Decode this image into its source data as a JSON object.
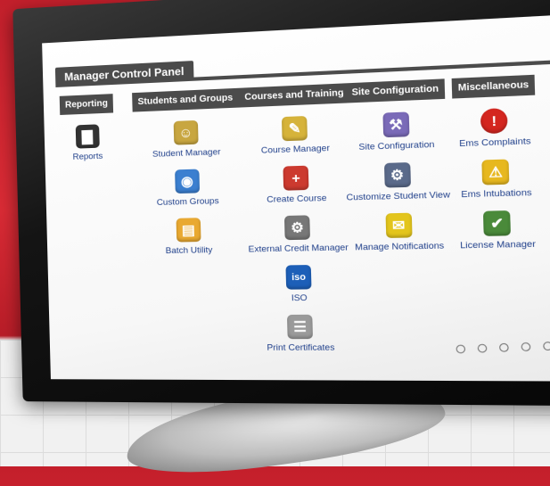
{
  "panel": {
    "title": "Manager Control Panel"
  },
  "columns": [
    {
      "header": "Reporting",
      "items": [
        {
          "label": "Reports",
          "icon": "chart-icon",
          "glyph": "▇",
          "color": "#333333"
        }
      ]
    },
    {
      "header": "Students and Groups",
      "items": [
        {
          "label": "Student Manager",
          "icon": "smiley-folder-icon",
          "glyph": "☺",
          "color": "#c8a640"
        },
        {
          "label": "Custom Groups",
          "icon": "group-icon",
          "glyph": "◉",
          "color": "#3b7fd0"
        },
        {
          "label": "Batch Utility",
          "icon": "folder-icon",
          "glyph": "▤",
          "color": "#e9a931"
        }
      ]
    },
    {
      "header": "Courses and Training",
      "items": [
        {
          "label": "Course Manager",
          "icon": "notebook-icon",
          "glyph": "✎",
          "color": "#d6b33a"
        },
        {
          "label": "Create Course",
          "icon": "add-course-icon",
          "glyph": "+",
          "color": "#cc3a2f"
        },
        {
          "label": "External Credit Manager",
          "icon": "gear-icon",
          "glyph": "⚙",
          "color": "#777777"
        },
        {
          "label": "ISO",
          "icon": "iso-icon",
          "glyph": "iso",
          "color": "#1d5fb8"
        },
        {
          "label": "Print Certificates",
          "icon": "certificate-icon",
          "glyph": "☰",
          "color": "#9a9a9a"
        }
      ]
    },
    {
      "header": "Site Configuration",
      "items": [
        {
          "label": "Site Configuration",
          "icon": "config-icon",
          "glyph": "⚒",
          "color": "#7a6ab8"
        },
        {
          "label": "Customize Student View",
          "icon": "customize-icon",
          "glyph": "⚙",
          "color": "#5a6a8a"
        },
        {
          "label": "Manage Notifications",
          "icon": "envelope-icon",
          "glyph": "✉",
          "color": "#e3c51c"
        }
      ]
    },
    {
      "header": "Miscellaneous",
      "items": [
        {
          "label": "Ems Complaints",
          "icon": "alert-icon",
          "glyph": "!",
          "color": "#d4261f"
        },
        {
          "label": "Ems Intubations",
          "icon": "warning-icon",
          "glyph": "⚠",
          "color": "#e7b81f"
        },
        {
          "label": "License Manager",
          "icon": "license-icon",
          "glyph": "✔",
          "color": "#4a8a3a"
        }
      ]
    }
  ]
}
